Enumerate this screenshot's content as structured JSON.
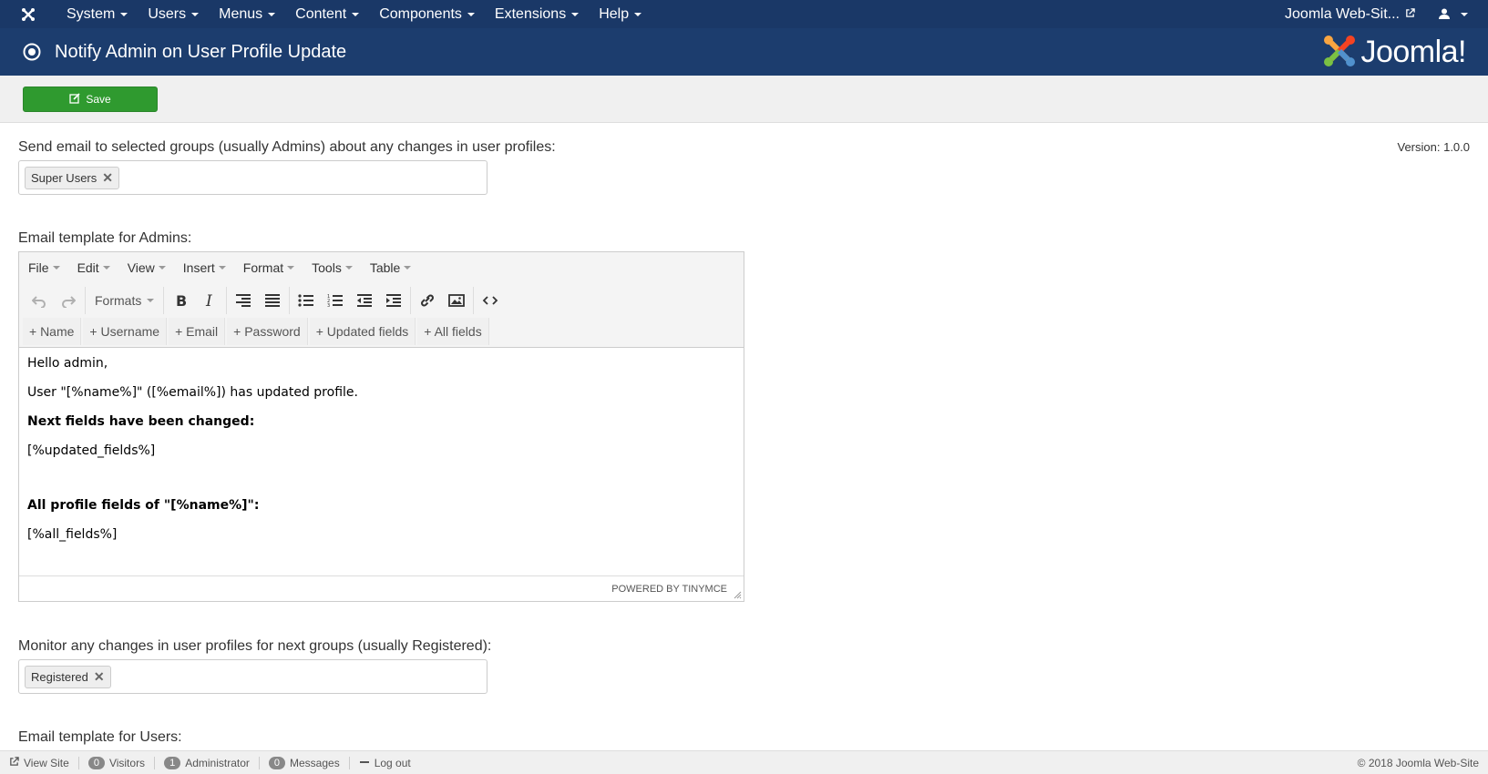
{
  "navbar": {
    "menu": [
      "System",
      "Users",
      "Menus",
      "Content",
      "Components",
      "Extensions",
      "Help"
    ],
    "site_link": "Joomla Web-Sit..."
  },
  "header": {
    "title": "Notify Admin on User Profile Update",
    "brand": "Joomla!"
  },
  "toolbar": {
    "save_label": "Save"
  },
  "version": "Version: 1.0.0",
  "admin_groups": {
    "label": "Send email to selected groups (usually Admins) about any changes in user profiles:",
    "tags": [
      "Super Users"
    ]
  },
  "admin_template": {
    "label": "Email template for Admins:",
    "menubar": [
      "File",
      "Edit",
      "View",
      "Insert",
      "Format",
      "Tools",
      "Table"
    ],
    "formats_label": "Formats",
    "insert_buttons": [
      "+ Name",
      "+ Username",
      "+ Email",
      "+ Password",
      "+ Updated fields",
      "+ All fields"
    ],
    "body": {
      "line1": "Hello admin,",
      "line2": "User \"[%name%]\" ([%email%]) has updated profile.",
      "line3": "Next fields have been changed:",
      "line4": "[%updated_fields%]",
      "line5": "All profile fields of \"[%name%]\":",
      "line6": "[%all_fields%]"
    },
    "powered_by": "POWERED BY TINYMCE"
  },
  "monitor_groups": {
    "label": "Monitor any changes in user profiles for next groups (usually Registered):",
    "tags": [
      "Registered"
    ]
  },
  "user_template": {
    "label": "Email template for Users:"
  },
  "statusbar": {
    "view_site": "View Site",
    "visitors_count": "0",
    "visitors_label": "Visitors",
    "admins_count": "1",
    "admins_label": "Administrator",
    "messages_count": "0",
    "messages_label": "Messages",
    "logout": "Log out",
    "copyright": "© 2018 Joomla Web-Site"
  },
  "colors": {
    "navbar_bg": "#1a3867",
    "header_bg": "#1c3d6e",
    "save_green": "#2f9a2f"
  },
  "icons": [
    "joomla-icon",
    "external-link-icon",
    "user-icon",
    "target-icon",
    "edit-icon",
    "undo-icon",
    "redo-icon",
    "bold-icon",
    "italic-icon",
    "align-right-icon",
    "justify-icon",
    "bullet-list-icon",
    "numbered-list-icon",
    "outdent-icon",
    "indent-icon",
    "link-icon",
    "image-icon",
    "code-icon",
    "close-icon",
    "logout-icon"
  ]
}
